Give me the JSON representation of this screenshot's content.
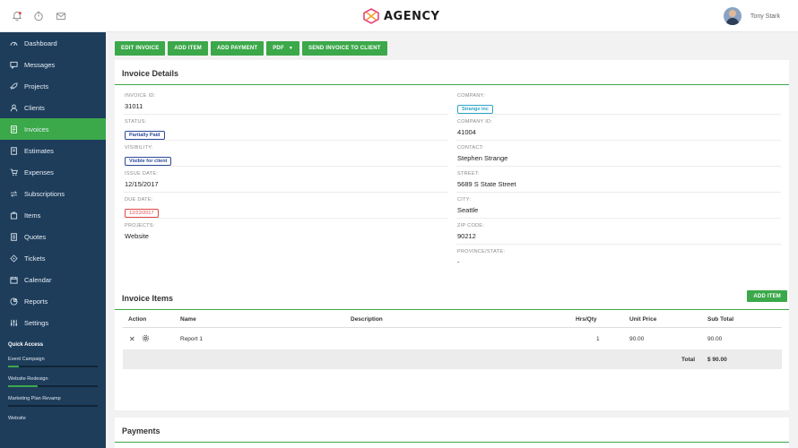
{
  "brand": {
    "name": "AGENCY"
  },
  "topbar": {
    "icons": [
      "bell-icon",
      "timer-icon",
      "mail-icon"
    ],
    "user_name": "Tony Stark"
  },
  "sidebar": {
    "items": [
      {
        "label": "Dashboard",
        "icon": "dashboard-icon",
        "active": false
      },
      {
        "label": "Messages",
        "icon": "messages-icon",
        "active": false
      },
      {
        "label": "Projects",
        "icon": "rocket-icon",
        "active": false
      },
      {
        "label": "Clients",
        "icon": "user-icon",
        "active": false
      },
      {
        "label": "Invoices",
        "icon": "invoice-icon",
        "active": true
      },
      {
        "label": "Estimates",
        "icon": "estimate-icon",
        "active": false
      },
      {
        "label": "Expenses",
        "icon": "cart-icon",
        "active": false
      },
      {
        "label": "Subscriptions",
        "icon": "refresh-icon",
        "active": false
      },
      {
        "label": "Items",
        "icon": "box-icon",
        "active": false
      },
      {
        "label": "Quotes",
        "icon": "quote-icon",
        "active": false
      },
      {
        "label": "Tickets",
        "icon": "ticket-icon",
        "active": false
      },
      {
        "label": "Calendar",
        "icon": "calendar-icon",
        "active": false
      },
      {
        "label": "Reports",
        "icon": "chart-icon",
        "active": false
      },
      {
        "label": "Settings",
        "icon": "sliders-icon",
        "active": false
      }
    ],
    "quick_access_title": "Quick Access",
    "quick_access": [
      {
        "label": "Event Campaign",
        "progress": 0.12
      },
      {
        "label": "Website Redesign",
        "progress": 0.33
      },
      {
        "label": "Marketing Plan Revamp",
        "progress": 0.0
      },
      {
        "label": "Website",
        "progress": 0.0
      }
    ]
  },
  "toolbar": {
    "edit_invoice": "EDIT INVOICE",
    "add_item": "ADD ITEM",
    "add_payment": "ADD PAYMENT",
    "pdf": "PDF",
    "send_invoice": "SEND INVOICE TO CLIENT"
  },
  "invoice_details": {
    "title": "Invoice Details",
    "left": {
      "invoice_id_label": "INVOICE ID:",
      "invoice_id": "31011",
      "status_label": "STATUS:",
      "status": "Partially Paid",
      "visibility_label": "VISIBILITY:",
      "visibility": "Visible for client",
      "issue_date_label": "ISSUE DATE:",
      "issue_date": "12/15/2017",
      "due_date_label": "DUE DATE:",
      "due_date": "12/22/2017",
      "projects_label": "PROJECTS:",
      "projects": "Website"
    },
    "right": {
      "company_label": "COMPANY:",
      "company": "Strange Inc",
      "company_id_label": "COMPANY ID:",
      "company_id": "41004",
      "contact_label": "CONTACT:",
      "contact": "Stephen Strange",
      "street_label": "STREET:",
      "street": "5689 S State Street",
      "city_label": "CITY:",
      "city": "Seattle",
      "zip_label": "ZIP CODE:",
      "zip": "90212",
      "province_label": "PROVINCE/STATE:",
      "province": "-"
    },
    "colors": {
      "accent": "#3ba84a",
      "status_blue": "#2c4a9a",
      "company_cyan": "#2ba5c9",
      "due_red": "#e04646"
    }
  },
  "invoice_items": {
    "title": "Invoice Items",
    "add_item": "ADD ITEM",
    "columns": {
      "action": "Action",
      "name": "Name",
      "description": "Description",
      "qty": "Hrs/Qty",
      "unit_price": "Unit Price",
      "subtotal": "Sub Total"
    },
    "rows": [
      {
        "name": "Report 1",
        "description": "",
        "qty": "1",
        "unit_price": "90.00",
        "subtotal": "90.00"
      }
    ],
    "total_label": "Total",
    "total": "$ 90.00"
  },
  "payments": {
    "title": "Payments"
  }
}
